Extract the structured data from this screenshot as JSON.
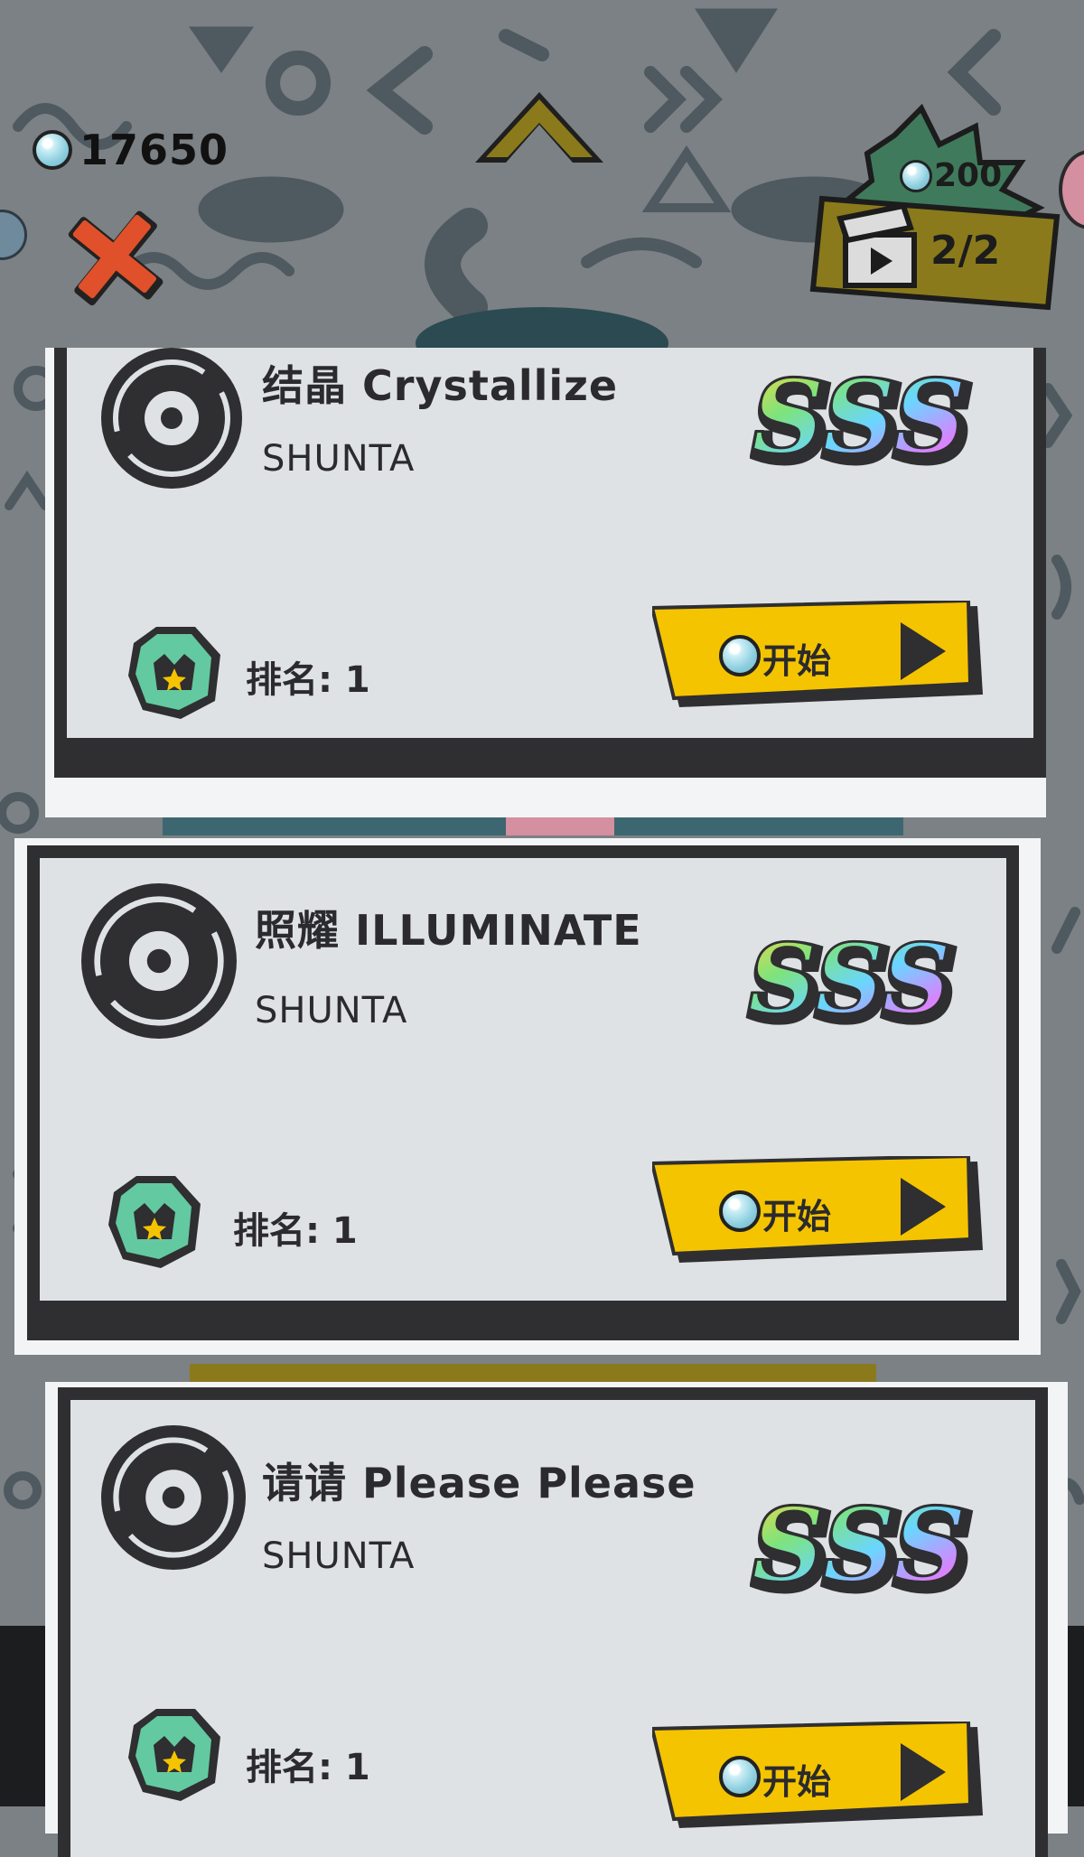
{
  "hud": {
    "gems": "17650",
    "ad_reward": "200",
    "ad_count": "2/2"
  },
  "songs": [
    {
      "title": "结晶 Crystallize",
      "artist": "SHUNTA",
      "grade": "SSS",
      "rank": "排名: 1",
      "start": "开始"
    },
    {
      "title": "照耀 ILLUMINATE",
      "artist": "SHUNTA",
      "grade": "SSS",
      "rank": "排名: 1",
      "start": "开始"
    },
    {
      "title": "请请 Please Please",
      "artist": "SHUNTA",
      "grade": "SSS",
      "rank": "排名: 1",
      "start": "开始"
    }
  ],
  "icons": {
    "gem": "gem-orb-icon",
    "close": "close-x-icon",
    "up": "up-chevron-icon",
    "ad": "clapperboard-icon",
    "disc": "record-disc-icon",
    "rank": "crown-rank-icon",
    "play": "play-triangle-icon"
  },
  "colors": {
    "background": "#7b8184",
    "card_panel": "#dfe2e5",
    "card_border": "#2f2e31",
    "start_button": "#f5c400",
    "close": "#e0502a",
    "rank_badge": "#63c9a0",
    "ad_banner": "#8a7a1c",
    "ad_burst": "#3f7a5c"
  }
}
